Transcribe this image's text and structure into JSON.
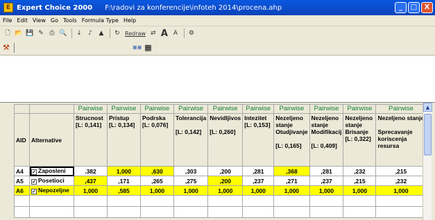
{
  "window": {
    "app_name": "Expert Choice 2000",
    "file_path": "F:\\radovi za konferencije\\infoteh 2014\\procena.ahp",
    "controls": {
      "minimize": "_",
      "maximize": "□",
      "close": "X"
    }
  },
  "menu": [
    "File",
    "Edit",
    "View",
    "Go",
    "Tools",
    "Formula Type",
    "Help"
  ],
  "toolbar": {
    "redraw_label": "Redraw"
  },
  "grid": {
    "header_row": {
      "aid": "AID",
      "alternative": "Alternative",
      "pairwise_label": "Pairwise"
    },
    "columns": [
      {
        "name": "Strucnost\n[L: 0,141]"
      },
      {
        "name": "Pristup\n[L: 0,134]"
      },
      {
        "name": "Podrska\n[L: 0,076]"
      },
      {
        "name": "Tolerancija\n\n[L: 0,142]"
      },
      {
        "name": "Nevidljivos\n\n[L: 0,260]"
      },
      {
        "name": "Intezitet\n[L: 0,153]"
      },
      {
        "name": "Nezeljeno stanje Otudjivanje\n\n[L: 0,165]"
      },
      {
        "name": "Nezeljeno stanje Modifikacij\n\n[L: 0,409]"
      },
      {
        "name": "Nezeljeno stanje Brisanje\n[L: 0,322]"
      },
      {
        "name": "Nezeljeno stanje\n\nSprecavanje koriscenja resursa"
      }
    ],
    "rows": [
      {
        "aid": "A4",
        "alternative": "Zaposleni",
        "values": [
          ".382",
          "1,000",
          ",630",
          ",303",
          ",200",
          ",281",
          ",368",
          ",281",
          ",232",
          ",215"
        ]
      },
      {
        "aid": "A5",
        "alternative": "Posetioci",
        "values": [
          ",437",
          ",171",
          ",265",
          ",275",
          ",200",
          ",237",
          ",271",
          ",237",
          ",215",
          ",232"
        ]
      },
      {
        "aid": "A6",
        "alternative": "Nepozeljne",
        "values": [
          "1,000",
          ",585",
          "1,000",
          "1,000",
          "1,000",
          "1,000",
          "1,000",
          "1,000",
          "1,000",
          "1,000"
        ]
      }
    ]
  },
  "colors": {
    "title_bar": "#0b4fd0",
    "highlight": "#ffff00",
    "pairwise_text": "#14803a"
  }
}
